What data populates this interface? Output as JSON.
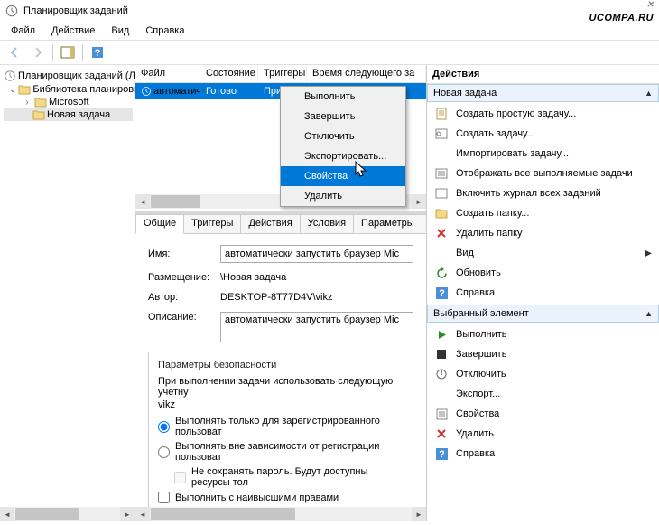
{
  "watermark": "UCOMPA.RU",
  "title": "Планировщик заданий",
  "menu": {
    "file": "Файл",
    "action": "Действие",
    "view": "Вид",
    "help": "Справка"
  },
  "tree": {
    "root": "Планировщик заданий (Лок",
    "lib": "Библиотека планировщ",
    "ms": "Microsoft",
    "new": "Новая задача"
  },
  "cols": {
    "file": "Файл",
    "state": "Состояние",
    "triggers": "Триггеры",
    "next": "Время следующего за"
  },
  "row": {
    "file": "автоматиче...",
    "state": "Готово",
    "trig": "При..."
  },
  "ctx": {
    "run": "Выполнить",
    "end": "Завершить",
    "disable": "Отключить",
    "export": "Экспортировать...",
    "props": "Свойства",
    "delete": "Удалить"
  },
  "tabs": {
    "general": "Общие",
    "triggers": "Триггеры",
    "actions": "Действия",
    "cond": "Условия",
    "params": "Параметры",
    "close": "X"
  },
  "form": {
    "name_l": "Имя:",
    "name_v": "автоматически запустить браузер Mic",
    "loc_l": "Размещение:",
    "loc_v": "\\Новая задача",
    "author_l": "Автор:",
    "author_v": "DESKTOP-8T77D4V\\vikz",
    "desc_l": "Описание:",
    "desc_v": "автоматически запустить браузер Mic"
  },
  "sec": {
    "legend": "Параметры безопасности",
    "acct": "При выполнении задачи использовать следующую учетну",
    "user": "vikz",
    "r1": "Выполнять только для зарегистрированного пользоват",
    "r2": "Выполнять вне зависимости от регистрации пользоват",
    "chk": "Не сохранять пароль. Будут доступны ресурсы тол",
    "hp": "Выполнить с наивысшими правами"
  },
  "actions": {
    "header": "Действия",
    "s1": "Новая задача",
    "a1": "Создать простую задачу...",
    "a2": "Создать задачу...",
    "a3": "Импортировать задачу...",
    "a4": "Отображать все выполняемые задачи",
    "a5": "Включить журнал всех заданий",
    "a6": "Создать папку...",
    "a7": "Удалить папку",
    "a8": "Вид",
    "a9": "Обновить",
    "a10": "Справка",
    "s2": "Выбранный элемент",
    "b1": "Выполнить",
    "b2": "Завершить",
    "b3": "Отключить",
    "b4": "Экспорт...",
    "b5": "Свойства",
    "b6": "Удалить",
    "b7": "Справка"
  }
}
